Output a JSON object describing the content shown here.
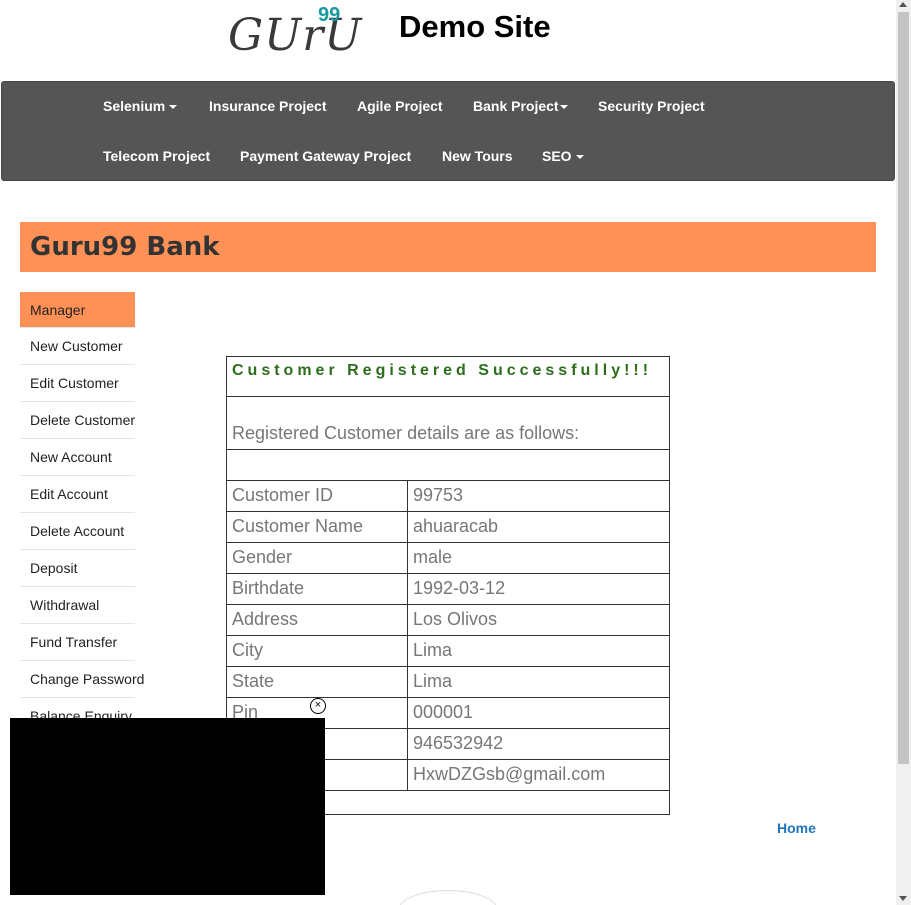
{
  "logo": {
    "text": "GUrU",
    "sup": "99"
  },
  "site_title": "Demo Site",
  "nav": {
    "row1": [
      {
        "label": "Selenium",
        "caret": true
      },
      {
        "label": "Insurance Project",
        "caret": false
      },
      {
        "label": "Agile Project",
        "caret": false
      },
      {
        "label": "Bank Project",
        "caret": true
      },
      {
        "label": "Security Project",
        "caret": false
      }
    ],
    "row2": [
      {
        "label": "Telecom Project",
        "caret": false
      },
      {
        "label": "Payment Gateway Project",
        "caret": false
      },
      {
        "label": "New Tours",
        "caret": false
      },
      {
        "label": "SEO",
        "caret": true
      }
    ]
  },
  "banner": {
    "title": "Guru99 Bank"
  },
  "sidebar": {
    "items": [
      "Manager",
      "New Customer",
      "Edit Customer",
      "Delete Customer",
      "New Account",
      "Edit Account",
      "Delete Account",
      "Deposit",
      "Withdrawal",
      "Fund Transfer",
      "Change Password",
      "Balance Enquiry"
    ],
    "active_index": 0
  },
  "result": {
    "heading": "Customer Registered Successfully!!!",
    "intro": "Registered Customer details are as follows:",
    "rows": [
      {
        "key": "Customer ID",
        "value": "99753"
      },
      {
        "key": "Customer Name",
        "value": "ahuaracab"
      },
      {
        "key": "Gender",
        "value": "male"
      },
      {
        "key": "Birthdate",
        "value": "1992-03-12"
      },
      {
        "key": "Address",
        "value": "Los Olivos"
      },
      {
        "key": "City",
        "value": "Lima"
      },
      {
        "key": "State",
        "value": "Lima"
      },
      {
        "key": "Pin",
        "value": "000001"
      },
      {
        "key": "",
        "value": "946532942"
      },
      {
        "key": "",
        "value": "HxwDZGsb@gmail.com"
      }
    ]
  },
  "home_link": "Home",
  "ad": {
    "close_glyph": "×"
  },
  "colors": {
    "accent": "#ff9157",
    "navbar": "#555555",
    "success": "#2c6e1c",
    "link": "#1f74b8"
  }
}
